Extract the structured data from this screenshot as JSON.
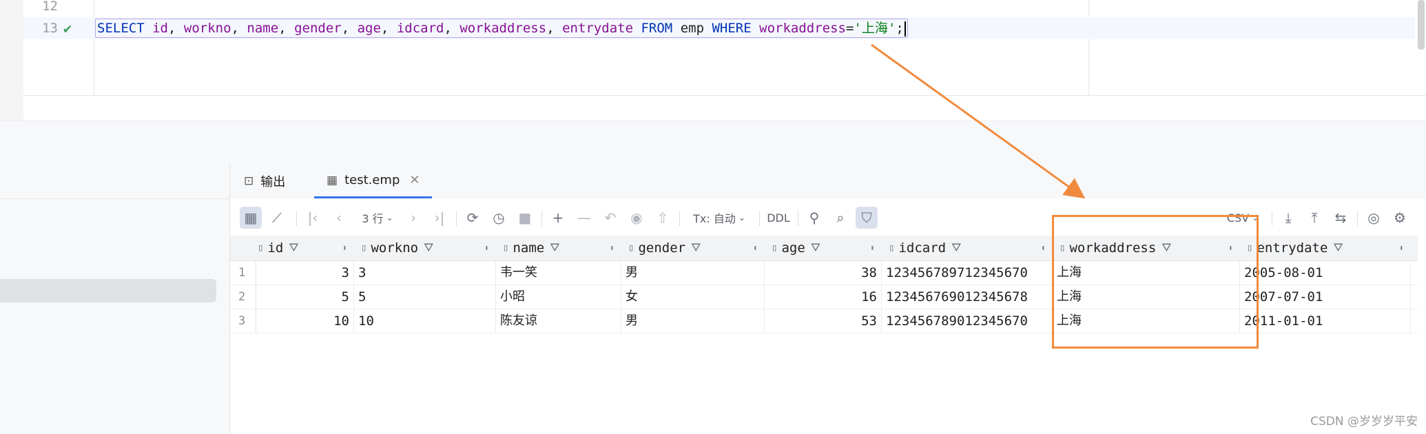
{
  "editor": {
    "lines": [
      {
        "number": "12"
      },
      {
        "number": "13",
        "status_icon": "check-icon",
        "sql": {
          "t1": "SELECT",
          "t2": "id",
          "t3": ", ",
          "t4": "workno",
          "t5": ", ",
          "t6": "name",
          "t7": ", ",
          "t8": "gender",
          "t9": ", ",
          "t10": "age",
          "t11": ", ",
          "t12": "idcard",
          "t13": ", ",
          "t14": "workaddress",
          "t15": ", ",
          "t16": "entrydate",
          "t17": "FROM",
          "t18": "emp",
          "t19": "WHERE",
          "t20": "workaddress",
          "t21": "=",
          "t22": "'上海'",
          "t23": ";"
        }
      }
    ]
  },
  "tabs": [
    {
      "icon": "console-icon",
      "label": "输出"
    },
    {
      "icon": "table-icon",
      "label": "test.emp",
      "active": true
    }
  ],
  "toolbar": {
    "rows_label": "3 行",
    "tx_label": "Tx: 自动",
    "ddl_label": "DDL",
    "export_format": "CSV"
  },
  "grid": {
    "columns": [
      {
        "name": "id"
      },
      {
        "name": "workno"
      },
      {
        "name": "name"
      },
      {
        "name": "gender"
      },
      {
        "name": "age"
      },
      {
        "name": "idcard"
      },
      {
        "name": "workaddress"
      },
      {
        "name": "entrydate"
      }
    ],
    "rows": [
      {
        "rownum": "1",
        "id": "3",
        "workno": "3",
        "name": "韦一笑",
        "gender": "男",
        "age": "38",
        "idcard": "123456789712345670",
        "workaddress": "上海",
        "entrydate": "2005-08-01"
      },
      {
        "rownum": "2",
        "id": "5",
        "workno": "5",
        "name": "小昭",
        "gender": "女",
        "age": "16",
        "idcard": "123456769012345678",
        "workaddress": "上海",
        "entrydate": "2007-07-01"
      },
      {
        "rownum": "3",
        "id": "10",
        "workno": "10",
        "name": "陈友谅",
        "gender": "男",
        "age": "53",
        "idcard": "123456789012345670",
        "workaddress": "上海",
        "entrydate": "2011-01-01"
      }
    ]
  },
  "annotation_color": "#f08a3c",
  "watermark": "CSDN @岁岁岁平安"
}
